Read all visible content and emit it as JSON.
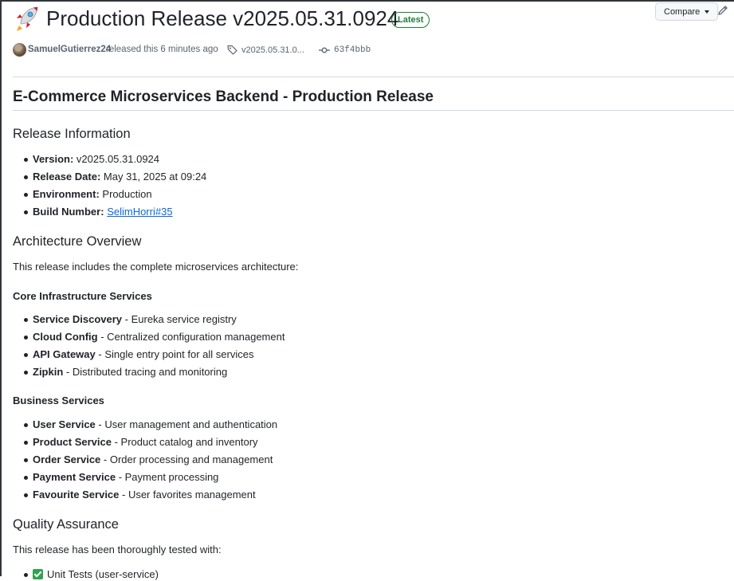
{
  "release": {
    "title": "Production Release v2025.05.31.0924",
    "badge": "Latest",
    "compare_label": "Compare",
    "author": "SamuelGutierrez24",
    "released_text": "released this 6 minutes ago",
    "tag": "v2025.05.31.0...",
    "commit": "63f4bbb"
  },
  "body": {
    "h1": "E-Commerce Microservices Backend - Production Release",
    "release_info": {
      "heading": "Release Information",
      "items": [
        {
          "label": "Version:",
          "value": "v2025.05.31.0924"
        },
        {
          "label": "Release Date:",
          "value": "May 31, 2025 at 09:24"
        },
        {
          "label": "Environment:",
          "value": "Production"
        },
        {
          "label": "Build Number:",
          "value": "SelimHorri#35"
        }
      ]
    },
    "architecture": {
      "heading": "Architecture Overview",
      "intro": "This release includes the complete microservices architecture:",
      "core": {
        "heading": "Core Infrastructure Services",
        "items": [
          {
            "name": "Service Discovery",
            "desc": " - Eureka service registry"
          },
          {
            "name": "Cloud Config",
            "desc": " - Centralized configuration management"
          },
          {
            "name": "API Gateway",
            "desc": " - Single entry point for all services"
          },
          {
            "name": "Zipkin",
            "desc": " - Distributed tracing and monitoring"
          }
        ]
      },
      "business": {
        "heading": "Business Services",
        "items": [
          {
            "name": "User Service",
            "desc": " - User management and authentication"
          },
          {
            "name": "Product Service",
            "desc": " - Product catalog and inventory"
          },
          {
            "name": "Order Service",
            "desc": " - Order processing and management"
          },
          {
            "name": "Payment Service",
            "desc": " - Payment processing"
          },
          {
            "name": "Favourite Service",
            "desc": " - User favorites management"
          }
        ]
      }
    },
    "qa": {
      "heading": "Quality Assurance",
      "intro": "This release has been thoroughly tested with:",
      "items": [
        "Unit Tests (user-service)"
      ]
    }
  },
  "icons": {
    "rocket": "rocket-icon",
    "edit": "pencil-icon",
    "tag": "tag-icon",
    "commit": "git-commit-icon",
    "check": "check-box-icon"
  },
  "colors": {
    "accent_green": "#1a7f37",
    "link": "#0969da",
    "text": "#1f2328",
    "muted": "#59636e"
  }
}
